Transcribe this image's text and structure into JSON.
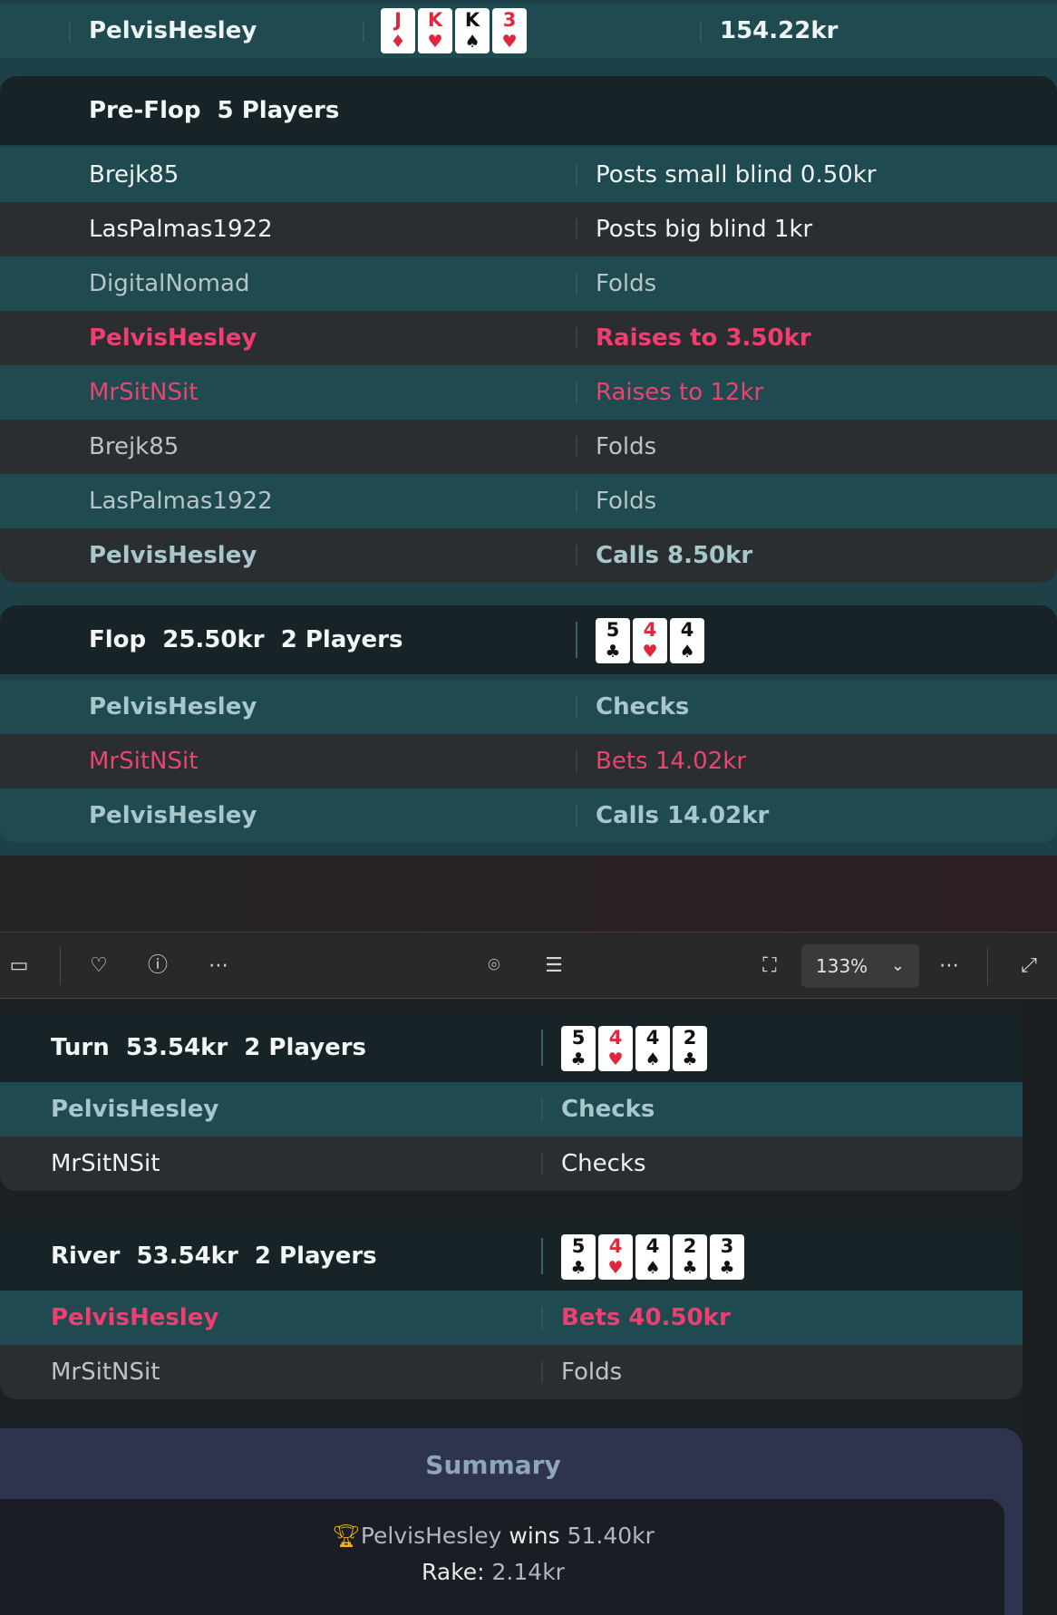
{
  "top_row": {
    "name": "PelvisHesley",
    "stack": "154.22kr",
    "cards": [
      {
        "rank": "J",
        "suit": "♦",
        "color": "red"
      },
      {
        "rank": "K",
        "suit": "♥",
        "color": "red"
      },
      {
        "rank": "K",
        "suit": "♠",
        "color": "black"
      },
      {
        "rank": "3",
        "suit": "♥",
        "color": "red"
      }
    ]
  },
  "preflop": {
    "title": "Pre-Flop  5 Players",
    "actions": [
      {
        "player": "Brejk85",
        "action": "Posts small blind 0.50kr"
      },
      {
        "player": "LasPalmas1922",
        "action": "Posts big blind 1kr"
      },
      {
        "player": "DigitalNomad",
        "action": "Folds"
      },
      {
        "player": "PelvisHesley",
        "action": "Raises to 3.50kr"
      },
      {
        "player": "MrSitNSit",
        "action": "Raises to 12kr"
      },
      {
        "player": "Brejk85",
        "action": "Folds"
      },
      {
        "player": "LasPalmas1922",
        "action": "Folds"
      },
      {
        "player": "PelvisHesley",
        "action": "Calls 8.50kr"
      }
    ]
  },
  "flop": {
    "title": "Flop  25.50kr  2 Players",
    "cards": [
      {
        "rank": "5",
        "suit": "♣",
        "color": "black"
      },
      {
        "rank": "4",
        "suit": "♥",
        "color": "red"
      },
      {
        "rank": "4",
        "suit": "♠",
        "color": "black"
      }
    ],
    "actions": [
      {
        "player": "PelvisHesley",
        "action": "Checks"
      },
      {
        "player": "MrSitNSit",
        "action": "Bets 14.02kr"
      },
      {
        "player": "PelvisHesley",
        "action": "Calls 14.02kr"
      }
    ]
  },
  "toolbar": {
    "zoom": "133%"
  },
  "turn": {
    "title": "Turn  53.54kr  2 Players",
    "cards": [
      {
        "rank": "5",
        "suit": "♣",
        "color": "black"
      },
      {
        "rank": "4",
        "suit": "♥",
        "color": "red"
      },
      {
        "rank": "4",
        "suit": "♠",
        "color": "black"
      },
      {
        "rank": "2",
        "suit": "♣",
        "color": "black"
      }
    ],
    "actions": [
      {
        "player": "PelvisHesley",
        "action": "Checks"
      },
      {
        "player": "MrSitNSit",
        "action": "Checks"
      }
    ]
  },
  "river": {
    "title": "River  53.54kr  2 Players",
    "cards": [
      {
        "rank": "5",
        "suit": "♣",
        "color": "black"
      },
      {
        "rank": "4",
        "suit": "♥",
        "color": "red"
      },
      {
        "rank": "4",
        "suit": "♠",
        "color": "black"
      },
      {
        "rank": "2",
        "suit": "♣",
        "color": "black"
      },
      {
        "rank": "3",
        "suit": "♣",
        "color": "black"
      }
    ],
    "actions": [
      {
        "player": "PelvisHesley",
        "action": "Bets 40.50kr"
      },
      {
        "player": "MrSitNSit",
        "action": "Folds"
      }
    ]
  },
  "summary": {
    "title": "Summary",
    "winner": "PelvisHesley",
    "wins_word": "wins",
    "amount": "51.40kr",
    "rake_label": "Rake:",
    "rake": "2.14kr"
  }
}
